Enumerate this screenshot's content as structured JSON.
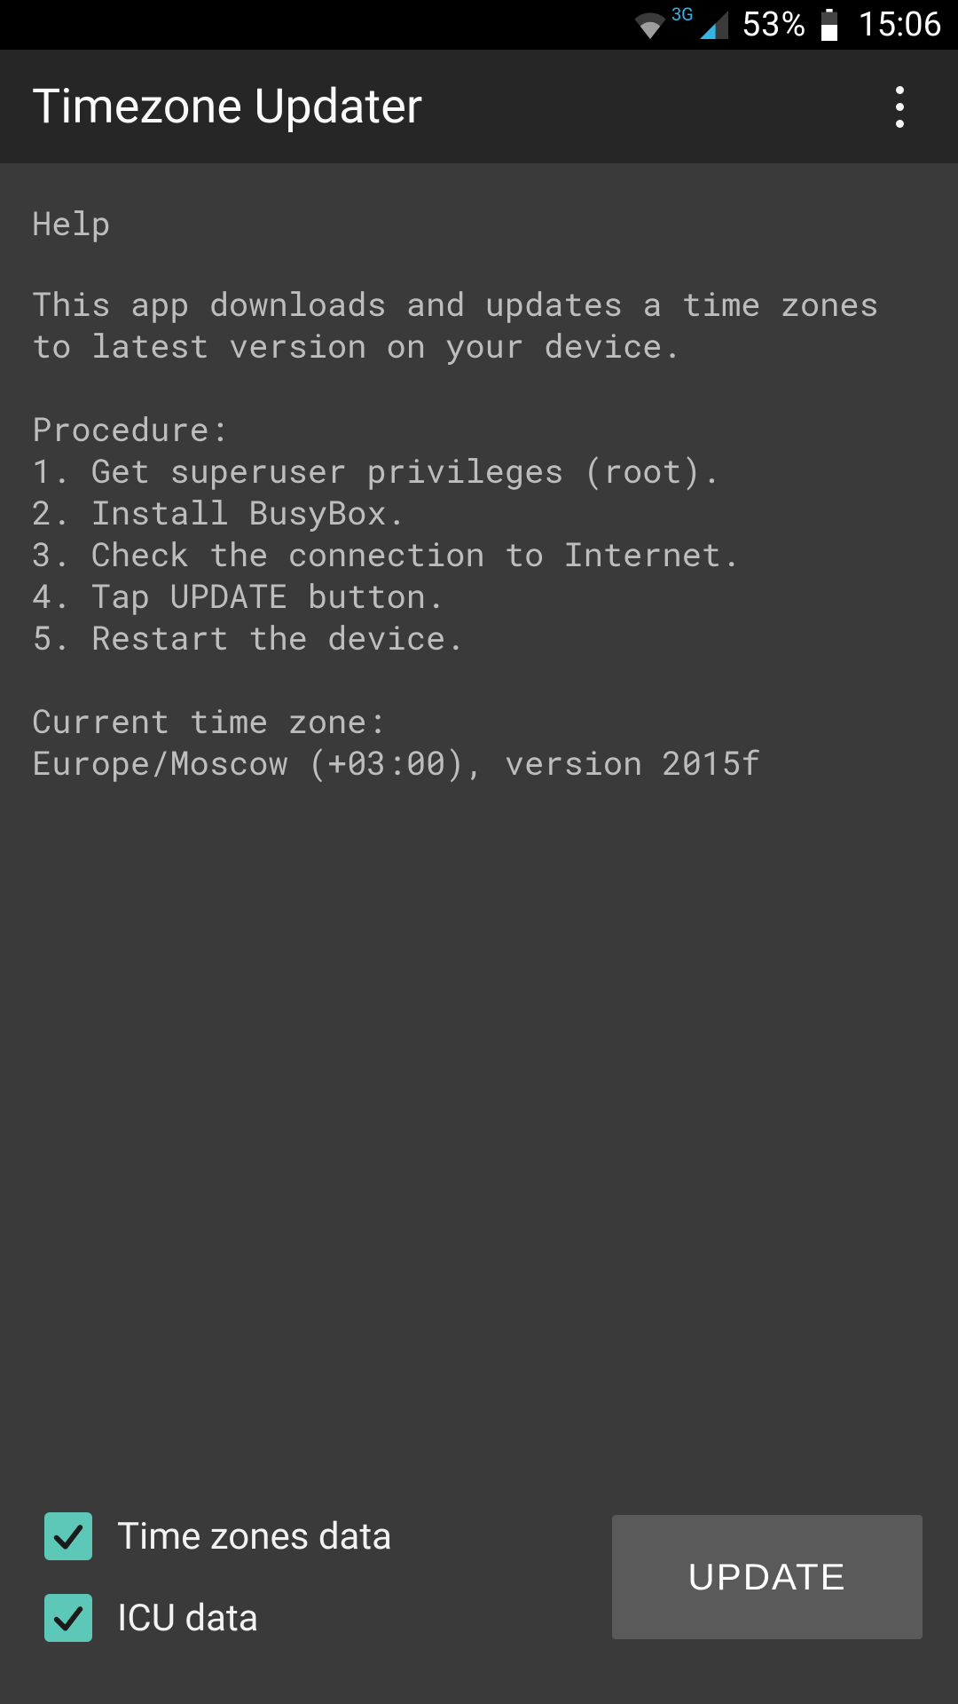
{
  "statusbar": {
    "network_type": "3G",
    "battery_pct": "53%",
    "clock": "15:06"
  },
  "appbar": {
    "title": "Timezone Updater"
  },
  "help": {
    "title": "Help",
    "intro": "This app downloads and updates a time zones to latest version on your device.",
    "procedure_label": "Procedure:",
    "steps": [
      "1. Get superuser privileges (root).",
      "2. Install BusyBox.",
      "3. Check the connection to Internet.",
      "4. Tap UPDATE button.",
      "5. Restart the device."
    ],
    "current_tz_label": "Current time zone:",
    "current_tz_value": "Europe/Moscow (+03:00), version 2015f"
  },
  "checks": {
    "tzdata_label": "Time zones data",
    "tzdata_checked": true,
    "icu_label": "ICU data",
    "icu_checked": true
  },
  "button": {
    "update_label": "UPDATE"
  },
  "colors": {
    "accent": "#5ec8b8"
  }
}
